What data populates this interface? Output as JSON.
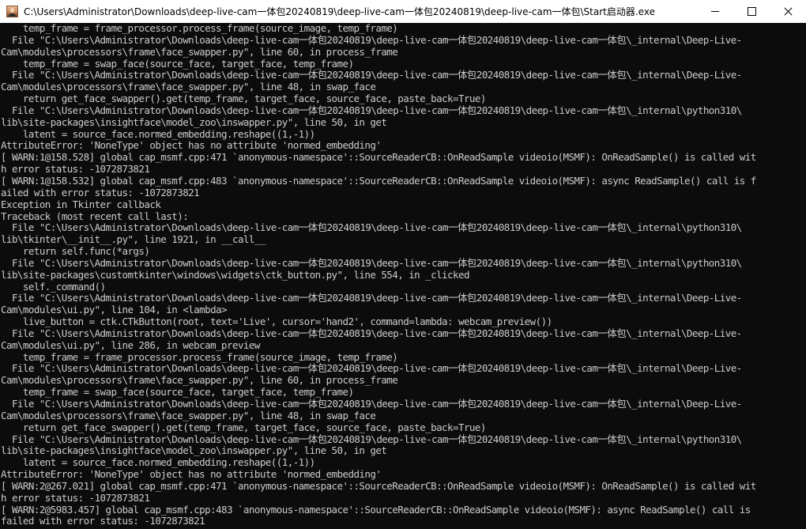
{
  "window": {
    "title": "C:\\Users\\Administrator\\Downloads\\deep-live-cam一体包20240819\\deep-live-cam一体包20240819\\deep-live-cam一体包\\Start启动器.exe"
  },
  "console": {
    "lines": [
      "    temp_frame = frame_processor.process_frame(source_image, temp_frame)",
      "  File \"C:\\Users\\Administrator\\Downloads\\deep-live-cam一体包20240819\\deep-live-cam一体包20240819\\deep-live-cam一体包\\_internal\\Deep-Live-",
      "Cam\\modules\\processors\\frame\\face_swapper.py\", line 60, in process_frame",
      "    temp_frame = swap_face(source_face, target_face, temp_frame)",
      "  File \"C:\\Users\\Administrator\\Downloads\\deep-live-cam一体包20240819\\deep-live-cam一体包20240819\\deep-live-cam一体包\\_internal\\Deep-Live-",
      "Cam\\modules\\processors\\frame\\face_swapper.py\", line 48, in swap_face",
      "    return get_face_swapper().get(temp_frame, target_face, source_face, paste_back=True)",
      "  File \"C:\\Users\\Administrator\\Downloads\\deep-live-cam一体包20240819\\deep-live-cam一体包20240819\\deep-live-cam一体包\\_internal\\python310\\",
      "lib\\site-packages\\insightface\\model_zoo\\inswapper.py\", line 50, in get",
      "    latent = source_face.normed_embedding.reshape((1,-1))",
      "AttributeError: 'NoneType' object has no attribute 'normed_embedding'",
      "[ WARN:1@158.528] global cap_msmf.cpp:471 `anonymous-namespace'::SourceReaderCB::OnReadSample videoio(MSMF): OnReadSample() is called wit",
      "h error status: -1072873821",
      "[ WARN:1@158.532] global cap_msmf.cpp:483 `anonymous-namespace'::SourceReaderCB::OnReadSample videoio(MSMF): async ReadSample() call is f",
      "ailed with error status: -1072873821",
      "Exception in Tkinter callback",
      "Traceback (most recent call last):",
      "  File \"C:\\Users\\Administrator\\Downloads\\deep-live-cam一体包20240819\\deep-live-cam一体包20240819\\deep-live-cam一体包\\_internal\\python310\\",
      "lib\\tkinter\\__init__.py\", line 1921, in __call__",
      "    return self.func(*args)",
      "  File \"C:\\Users\\Administrator\\Downloads\\deep-live-cam一体包20240819\\deep-live-cam一体包20240819\\deep-live-cam一体包\\_internal\\python310\\",
      "lib\\site-packages\\customtkinter\\windows\\widgets\\ctk_button.py\", line 554, in _clicked",
      "    self._command()",
      "  File \"C:\\Users\\Administrator\\Downloads\\deep-live-cam一体包20240819\\deep-live-cam一体包20240819\\deep-live-cam一体包\\_internal\\Deep-Live-",
      "Cam\\modules\\ui.py\", line 104, in <lambda>",
      "    live_button = ctk.CTkButton(root, text='Live', cursor='hand2', command=lambda: webcam_preview())",
      "  File \"C:\\Users\\Administrator\\Downloads\\deep-live-cam一体包20240819\\deep-live-cam一体包20240819\\deep-live-cam一体包\\_internal\\Deep-Live-",
      "Cam\\modules\\ui.py\", line 286, in webcam_preview",
      "    temp_frame = frame_processor.process_frame(source_image, temp_frame)",
      "  File \"C:\\Users\\Administrator\\Downloads\\deep-live-cam一体包20240819\\deep-live-cam一体包20240819\\deep-live-cam一体包\\_internal\\Deep-Live-",
      "Cam\\modules\\processors\\frame\\face_swapper.py\", line 60, in process_frame",
      "    temp_frame = swap_face(source_face, target_face, temp_frame)",
      "  File \"C:\\Users\\Administrator\\Downloads\\deep-live-cam一体包20240819\\deep-live-cam一体包20240819\\deep-live-cam一体包\\_internal\\Deep-Live-",
      "Cam\\modules\\processors\\frame\\face_swapper.py\", line 48, in swap_face",
      "    return get_face_swapper().get(temp_frame, target_face, source_face, paste_back=True)",
      "  File \"C:\\Users\\Administrator\\Downloads\\deep-live-cam一体包20240819\\deep-live-cam一体包20240819\\deep-live-cam一体包\\_internal\\python310\\",
      "lib\\site-packages\\insightface\\model_zoo\\inswapper.py\", line 50, in get",
      "    latent = source_face.normed_embedding.reshape((1,-1))",
      "AttributeError: 'NoneType' object has no attribute 'normed_embedding'",
      "[ WARN:2@267.021] global cap_msmf.cpp:471 `anonymous-namespace'::SourceReaderCB::OnReadSample videoio(MSMF): OnReadSample() is called wit",
      "h error status: -1072873821",
      "[ WARN:2@5983.457] global cap_msmf.cpp:483 `anonymous-namespace'::SourceReaderCB::OnReadSample videoio(MSMF): async ReadSample() call is ",
      "failed with error status: -1072873821"
    ]
  }
}
